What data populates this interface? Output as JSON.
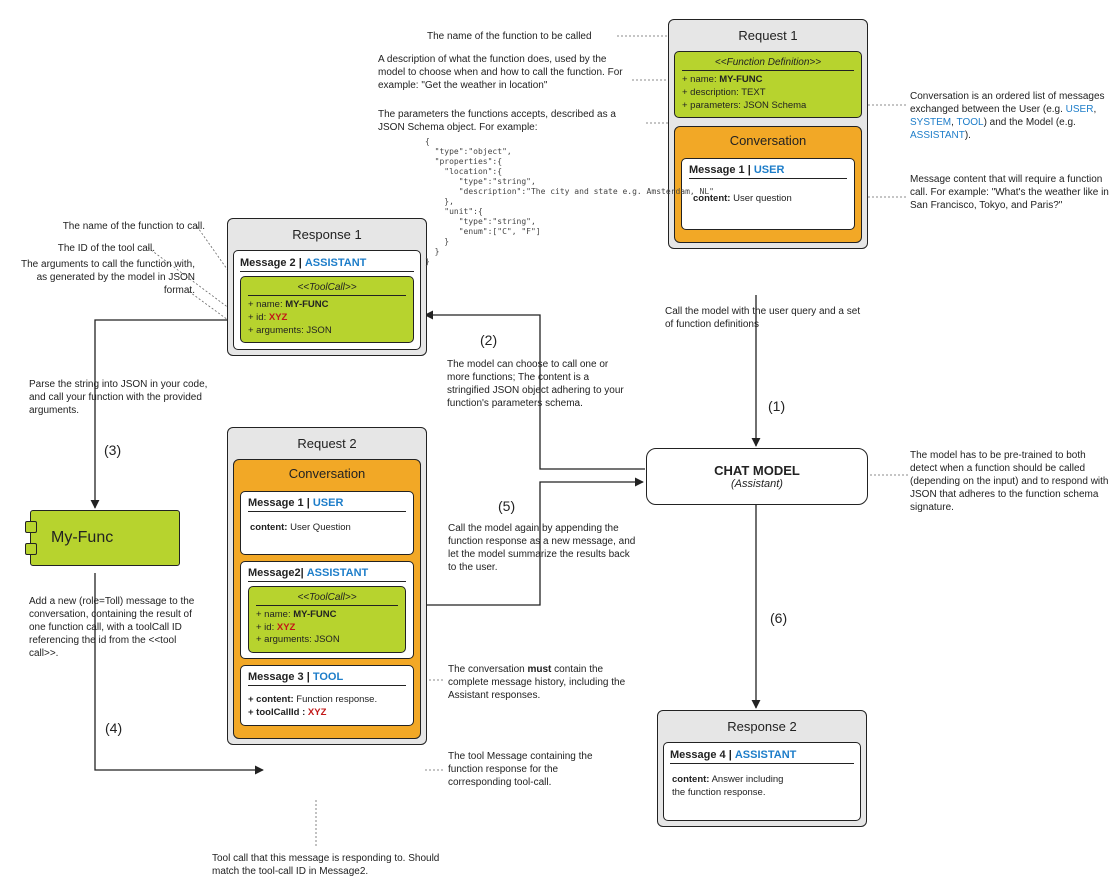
{
  "request1": {
    "title": "Request 1",
    "funcdef": {
      "stereo": "<<Function Definition>>",
      "name_label": "+ name:",
      "name_value": "MY-FUNC",
      "desc_label": "+ description: TEXT",
      "params_label": "+ parameters: JSON Schema"
    },
    "conv_title": "Conversation",
    "msg1": {
      "head_prefix": "Message 1 | ",
      "role": "USER",
      "content_label": "content:",
      "content_value": "  User question"
    }
  },
  "response1": {
    "title": "Response 1",
    "msg2": {
      "head_prefix": "Message 2 | ",
      "role": "ASSISTANT",
      "tool": {
        "stereo": "<<ToolCall>>",
        "name_label": "+ name:",
        "name_value": "MY-FUNC",
        "id_label": "+ id:",
        "id_value": "XYZ",
        "args_label": "+ arguments: JSON"
      }
    }
  },
  "request2": {
    "title": "Request 2",
    "conv_title": "Conversation",
    "msg1": {
      "head_prefix": "Message 1 | ",
      "role": "USER",
      "content_label": "content:",
      "content_value": " User Question"
    },
    "msg2": {
      "head_prefix": "Message2| ",
      "role": "ASSISTANT",
      "tool": {
        "stereo": "<<ToolCall>>",
        "name_label": "+ name:",
        "name_value": "MY-FUNC",
        "id_label": "+ id:",
        "id_value": "XYZ",
        "args_label": "+ arguments: JSON"
      }
    },
    "msg3": {
      "head_prefix": "Message 3 | ",
      "role": "TOOL",
      "content_label": "+ content:",
      "content_value": " Function response.",
      "tcid_label": "+ toolCallId :",
      "tcid_value": "XYZ"
    }
  },
  "response2": {
    "title": "Response 2",
    "msg4": {
      "head_prefix": "Message 4 | ",
      "role": "ASSISTANT",
      "content_label": "content:",
      "content_value": " Answer including\nthe function response."
    }
  },
  "chat": {
    "title": "CHAT MODEL",
    "subtitle": "(Assistant)"
  },
  "myfunc": "My-Func",
  "steps": {
    "s1": "(1)",
    "s2": "(2)",
    "s3": "(3)",
    "s4": "(4)",
    "s5": "(5)",
    "s6": "(6)"
  },
  "notes": {
    "fn_name": "The name of the function to be called",
    "fn_desc": "A description of what the function does, used by the model to choose when and how to call the function. For example: \"Get the weather in location\"",
    "fn_params": "The parameters the functions accepts, described as a JSON Schema object.  For example:",
    "conv_desc_a": "Conversation is an ordered list of messages exchanged between the User (e.g. ",
    "conv_desc_b": ", ",
    "conv_desc_c": ") and the Model (e.g. ",
    "conv_desc_d": ").",
    "conv_roles": {
      "user": "USER",
      "system": "SYSTEM",
      "tool": "TOOL",
      "assistant": "ASSISTANT"
    },
    "msg1_note": "Message content that will require a function call. For example: \"What's the weather like in San Francisco, Tokyo, and Paris?\"",
    "call_with": "Call the model with the user query and a set of function definitions",
    "pretrain": "The model has to be pre-trained to both detect when a function should be called (depending on the input) and to respond with JSON that adheres to the function  schema signature.",
    "choose": "The model can choose to call one or more functions; The content is a stringified JSON object adhering to your function's parameters schema.",
    "tc_name": "The name of the function to call.",
    "tc_id": "The ID of the tool call.",
    "tc_args": "The arguments to call the function with, as generated by the model in JSON format.",
    "parse": "Parse the string into JSON in your code, and call your function with the provided arguments.",
    "addmsg": "Add a new (role=Toll) message to the conversation, containing the result of one function call, with a toolCall ID referencing  the id from the <<tool call>>.",
    "append": "Call the model again by appending the function response as a new message, and let the model summarize the results back to the user.",
    "hist_a": "The conversation ",
    "hist_b": "must",
    "hist_c": " contain the complete message history, including the Assistant responses.",
    "toolmsg": "The tool Message containing the function response for the corresponding tool-call.",
    "foot": "Tool call that this message is responding to. Should match the tool-call ID in Message2."
  },
  "schema": "{\n  \"type\":\"object\",\n  \"properties\":{\n    \"location\":{\n       \"type\":\"string\",\n       \"description\":\"The city and state e.g. Amsterdam, NL\"\n    },\n    \"unit\":{\n       \"type\":\"string\",\n       \"enum\":[\"C\", \"F\"]\n    }\n  }\n}"
}
